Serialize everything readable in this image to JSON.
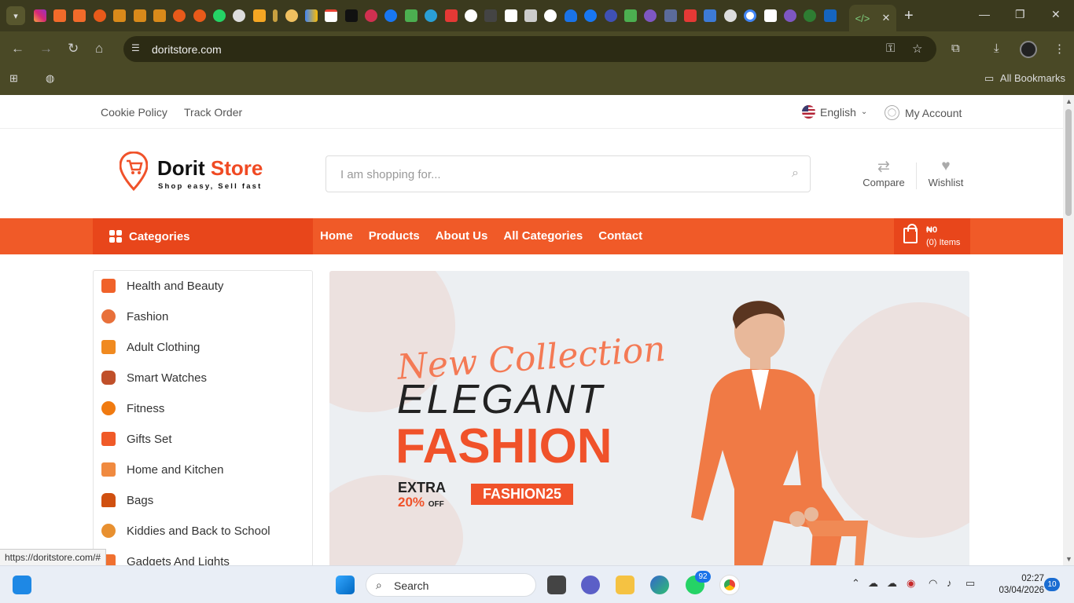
{
  "browser": {
    "url": "doritstore.com",
    "bookmarks_label": "All Bookmarks",
    "status_link": "https://doritstore.com/#",
    "tab_close": "✕",
    "new_tab": "+"
  },
  "topbar": {
    "links": [
      "Cookie Policy",
      "Track Order"
    ],
    "language": "English",
    "account": "My Account"
  },
  "header": {
    "logo_name_a": "Dorit ",
    "logo_name_b": "Store",
    "logo_tagline": "Shop easy, Sell fast",
    "search_placeholder": "I am shopping for...",
    "compare_label": "Compare",
    "wishlist_label": "Wishlist"
  },
  "navbar": {
    "categories_label": "Categories",
    "menu": [
      "Home",
      "Products",
      "About Us",
      "All Categories",
      "Contact"
    ],
    "cart_amount": "₦0",
    "cart_items": "(0) Items"
  },
  "sidebar": {
    "categories": [
      {
        "label": "Health and Beauty",
        "color": "#f0622a"
      },
      {
        "label": "Fashion",
        "color": "#e8703a"
      },
      {
        "label": "Adult Clothing",
        "color": "#f08a20"
      },
      {
        "label": "Smart Watches",
        "color": "#c0502a"
      },
      {
        "label": "Fitness",
        "color": "#f07a10"
      },
      {
        "label": "Gifts Set",
        "color": "#f05a28"
      },
      {
        "label": "Home and Kitchen",
        "color": "#f08a40"
      },
      {
        "label": "Bags",
        "color": "#d05010"
      },
      {
        "label": "Kiddies and Back to School",
        "color": "#e89030"
      },
      {
        "label": "Gadgets And Lights",
        "color": "#f07030"
      }
    ]
  },
  "banner": {
    "line1": "New Collection",
    "line2": "ELEGANT",
    "line3": "FASHION",
    "extra": "EXTRA",
    "discount": "20%",
    "discount_suffix": "OFF",
    "code": "FASHION25"
  },
  "taskbar": {
    "search": "Search",
    "whatsapp_badge": "92",
    "time": "02:27",
    "date": "03/04/2026",
    "notifications": "10"
  },
  "colors": {
    "accent": "#f05a28",
    "accent_dark": "#e8461b",
    "chrome_bg": "#4a4926"
  }
}
